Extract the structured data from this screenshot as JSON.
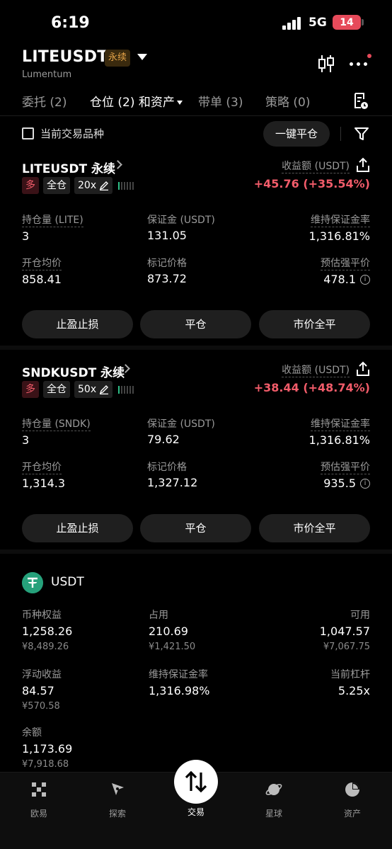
{
  "status": {
    "time": "6:19",
    "network": "5G",
    "battery": "14"
  },
  "header": {
    "symbol": "LITEUSDT",
    "contract_tag": "永续",
    "subtitle": "Lumentum"
  },
  "tabs": [
    {
      "label": "委托 (2)",
      "active": false
    },
    {
      "label": "仓位 (2) 和资产",
      "active": true
    },
    {
      "label": "带单 (3)",
      "active": false
    },
    {
      "label": "策略 (0)",
      "active": false
    }
  ],
  "filter": {
    "checkbox_label": "当前交易品种",
    "close_all_button": "一键平仓"
  },
  "positions": [
    {
      "name": "LITEUSDT 永续",
      "pnl_label": "收益额 (USDT)",
      "pnl": "+45.76 (+35.54%)",
      "side_tag": "多",
      "margin_mode": "全仓",
      "leverage": "20x",
      "size_label": "持仓量 (LITE)",
      "size": "3",
      "margin_label": "保证金 (USDT)",
      "margin": "131.05",
      "mmr_label": "维持保证金率",
      "mmr": "1,316.81%",
      "entry_label": "开仓均价",
      "entry": "858.41",
      "mark_label": "标记价格",
      "mark": "873.72",
      "liq_label": "预估强平价",
      "liq": "478.1",
      "buttons": [
        "止盈止损",
        "平仓",
        "市价全平"
      ]
    },
    {
      "name": "SNDKUSDT 永续",
      "pnl_label": "收益额 (USDT)",
      "pnl": "+38.44 (+48.74%)",
      "side_tag": "多",
      "margin_mode": "全仓",
      "leverage": "50x",
      "size_label": "持仓量 (SNDK)",
      "size": "3",
      "margin_label": "保证金 (USDT)",
      "margin": "79.62",
      "mmr_label": "维持保证金率",
      "mmr": "1,316.81%",
      "entry_label": "开仓均价",
      "entry": "1,314.3",
      "mark_label": "标记价格",
      "mark": "1,327.12",
      "liq_label": "预估强平价",
      "liq": "935.5",
      "buttons": [
        "止盈止损",
        "平仓",
        "市价全平"
      ]
    }
  ],
  "assets": {
    "coin": "USDT",
    "equity_label": "币种权益",
    "equity": "1,258.26",
    "equity_cny": "¥8,489.26",
    "used_label": "占用",
    "used": "210.69",
    "used_cny": "¥1,421.50",
    "avail_label": "可用",
    "avail": "1,047.57",
    "avail_cny": "¥7,067.75",
    "upl_label": "浮动收益",
    "upl": "84.57",
    "upl_cny": "¥570.58",
    "mmr_label": "维持保证金率",
    "mmr": "1,316.98%",
    "lev_label": "当前杠杆",
    "lev": "5.25x",
    "bal_label": "余额",
    "bal": "1,173.69",
    "bal_cny": "¥7,918.68"
  },
  "nav": [
    {
      "label": "欧易",
      "icon": "okx-logo-icon"
    },
    {
      "label": "探索",
      "icon": "compass-icon"
    },
    {
      "label": "交易",
      "icon": "trade-arrows-icon"
    },
    {
      "label": "星球",
      "icon": "planet-icon"
    },
    {
      "label": "资产",
      "icon": "pie-chart-icon"
    }
  ],
  "colors": {
    "profit": "#f25c6a",
    "accent_tag": "#e3a248",
    "usdt": "#26a17b"
  }
}
